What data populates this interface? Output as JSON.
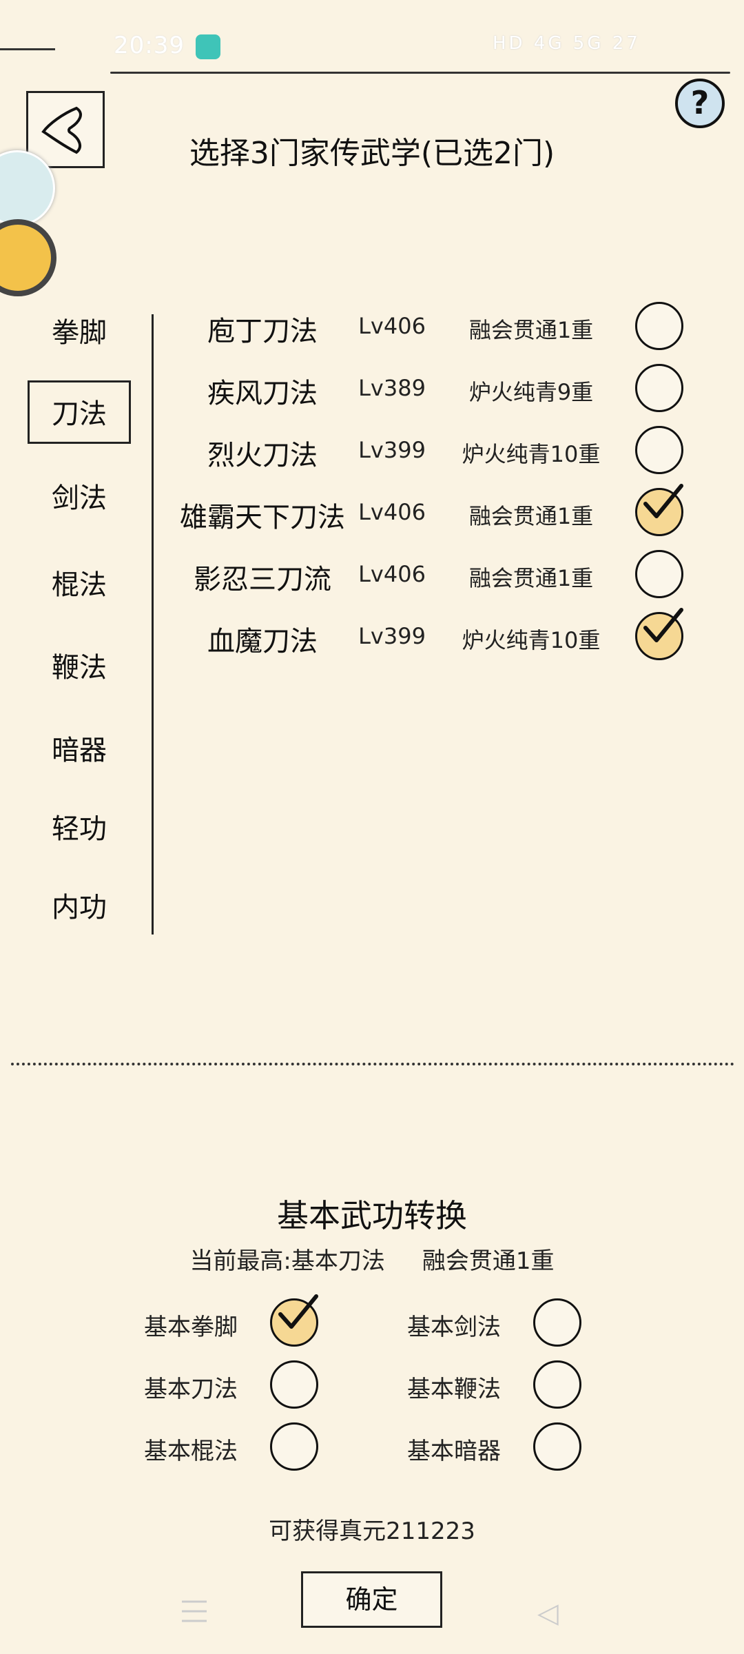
{
  "status_bar": {
    "time": "20:39",
    "right_indicators": "HD 4G 5G 27"
  },
  "header": {
    "title": "选择3门家传武学(已选2门)",
    "help_label": "?"
  },
  "categories": [
    {
      "label": "拳脚",
      "selected": false
    },
    {
      "label": "刀法",
      "selected": true
    },
    {
      "label": "剑法",
      "selected": false
    },
    {
      "label": "棍法",
      "selected": false
    },
    {
      "label": "鞭法",
      "selected": false
    },
    {
      "label": "暗器",
      "selected": false
    },
    {
      "label": "轻功",
      "selected": false
    },
    {
      "label": "内功",
      "selected": false
    }
  ],
  "skills": [
    {
      "name": "庖丁刀法",
      "level": "Lv406",
      "rank": "融会贯通1重",
      "checked": false
    },
    {
      "name": "疾风刀法",
      "level": "Lv389",
      "rank": "炉火纯青9重",
      "checked": false
    },
    {
      "name": "烈火刀法",
      "level": "Lv399",
      "rank": "炉火纯青10重",
      "checked": false
    },
    {
      "name": "雄霸天下刀法",
      "level": "Lv406",
      "rank": "融会贯通1重",
      "checked": true
    },
    {
      "name": "影忍三刀流",
      "level": "Lv406",
      "rank": "融会贯通1重",
      "checked": false
    },
    {
      "name": "血魔刀法",
      "level": "Lv399",
      "rank": "炉火纯青10重",
      "checked": true
    }
  ],
  "conversion": {
    "title": "基本武功转换",
    "current": "当前最高:基本刀法     融会贯通1重",
    "options": [
      {
        "label": "基本拳脚",
        "checked": true
      },
      {
        "label": "基本剑法",
        "checked": false
      },
      {
        "label": "基本刀法",
        "checked": false
      },
      {
        "label": "基本鞭法",
        "checked": false
      },
      {
        "label": "基本棍法",
        "checked": false
      },
      {
        "label": "基本暗器",
        "checked": false
      }
    ],
    "reward": "可获得真元211223",
    "confirm_label": "确定"
  },
  "colors": {
    "background": "#faf3e3",
    "check_fill": "#f6d894",
    "ink": "#111111"
  }
}
